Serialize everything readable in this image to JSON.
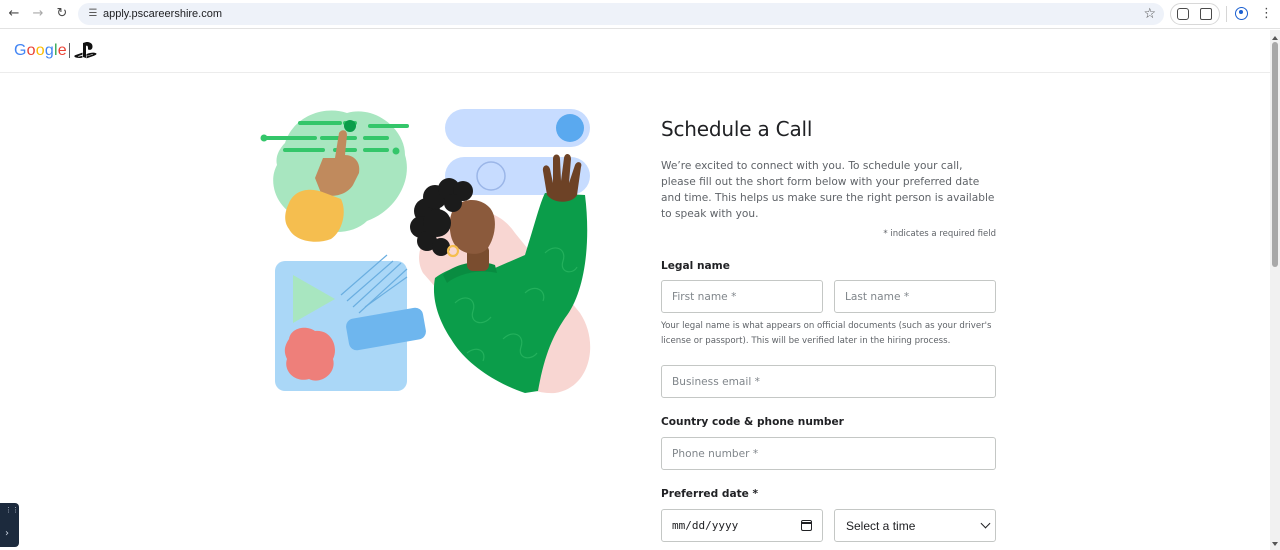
{
  "browser": {
    "url": "apply.pscareershire.com",
    "icons": [
      "back-arrow-icon",
      "forward-arrow-icon",
      "reload-icon",
      "site-info-icon",
      "bookmark-star-icon",
      "extension-icon",
      "puzzle-icon",
      "profile-icon",
      "kebab-menu-icon"
    ]
  },
  "header": {
    "google_letters": [
      "G",
      "o",
      "o",
      "g",
      "l",
      "e"
    ],
    "google_colors": [
      "#4285F4",
      "#EA4335",
      "#FBBC05",
      "#4285F4",
      "#34A853",
      "#EA4335"
    ],
    "brand_icon": "playstation-logo-icon"
  },
  "illustration": {
    "name": "woman-waving-with-ui-shapes-illustration",
    "colors": {
      "green": "#0b9d4a",
      "blue_light": "#c7dcff",
      "blue_dot": "#5aa9ef",
      "pink": "#f8d6d2",
      "skin": "#8b5a3c",
      "mint": "#a8e6c0"
    }
  },
  "form": {
    "title": "Schedule a Call",
    "intro": "We’re excited to connect with you. To schedule your call, please fill out the short form below with your preferred date and time. This helps us make sure the right person is available to speak with you.",
    "required_note": "* indicates a required field",
    "legal_name_label": "Legal name",
    "first_name_placeholder": "First name *",
    "last_name_placeholder": "Last name *",
    "legal_name_helper": "Your legal name is what appears on official documents (such as your driver's license or passport). This will be verified later in the hiring process.",
    "email_placeholder": "Business email *",
    "phone_label": "Country code & phone number",
    "phone_placeholder": "Phone number *",
    "date_label": "Preferred date *",
    "date_value": "mm/dd/yyyy",
    "time_selected": "Select a time"
  }
}
